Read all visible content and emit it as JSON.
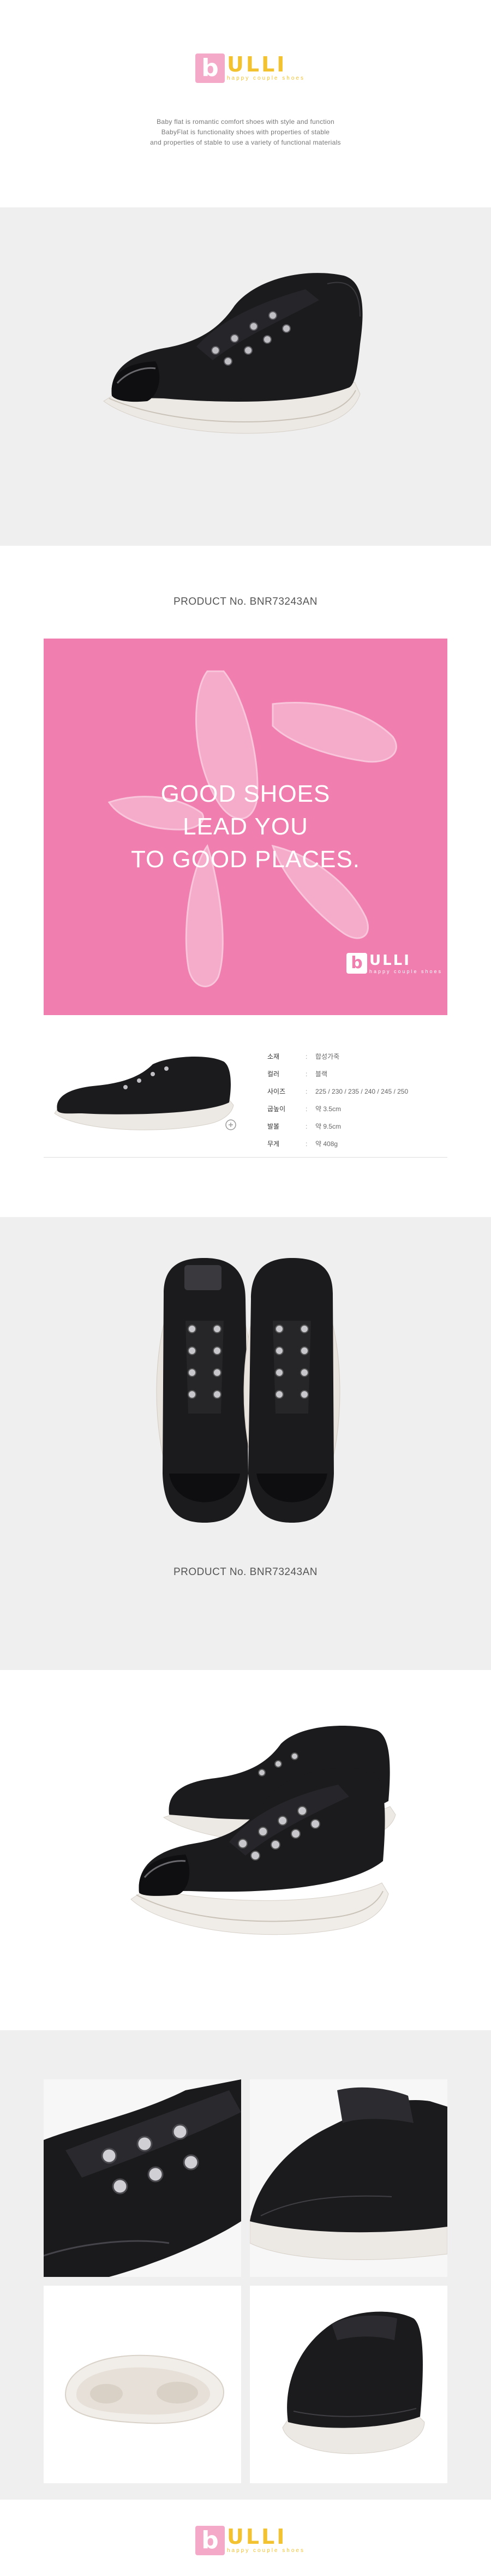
{
  "brand": {
    "logo_letter": "b",
    "logo_text": "ULLI",
    "tagline": "happy couple shoes"
  },
  "intro": {
    "line1": "Baby flat is romantic comfort shoes with style and function",
    "line2": "BabyFlat is functionality shoes with properties of stable",
    "line3": "and properties of stable to use a variety of functional materials"
  },
  "product": {
    "number_label": "PRODUCT No. BNR73243AN"
  },
  "banner": {
    "line1": "GOOD SHOES",
    "line2": "LEAD YOU",
    "line3": "TO GOOD PLACES.",
    "logo_letter": "b",
    "logo_text": "ULLI",
    "tagline": "happy couple shoes"
  },
  "spec": {
    "rows": [
      {
        "label": "소재",
        "value": "합성가죽"
      },
      {
        "label": "컬러",
        "value": "블랙"
      },
      {
        "label": "사이즈",
        "value": "225 / 230 / 235 / 240 / 245 / 250"
      },
      {
        "label": "굽높이",
        "value": "약 3.5cm"
      },
      {
        "label": "발볼",
        "value": "약 9.5cm"
      },
      {
        "label": "무게",
        "value": "약 408g"
      }
    ]
  },
  "colors": {
    "brand_pink": "#f4a9c8",
    "brand_yellow": "#f2c230",
    "banner_pink": "#f07fb0",
    "section_grey": "#efefef"
  }
}
